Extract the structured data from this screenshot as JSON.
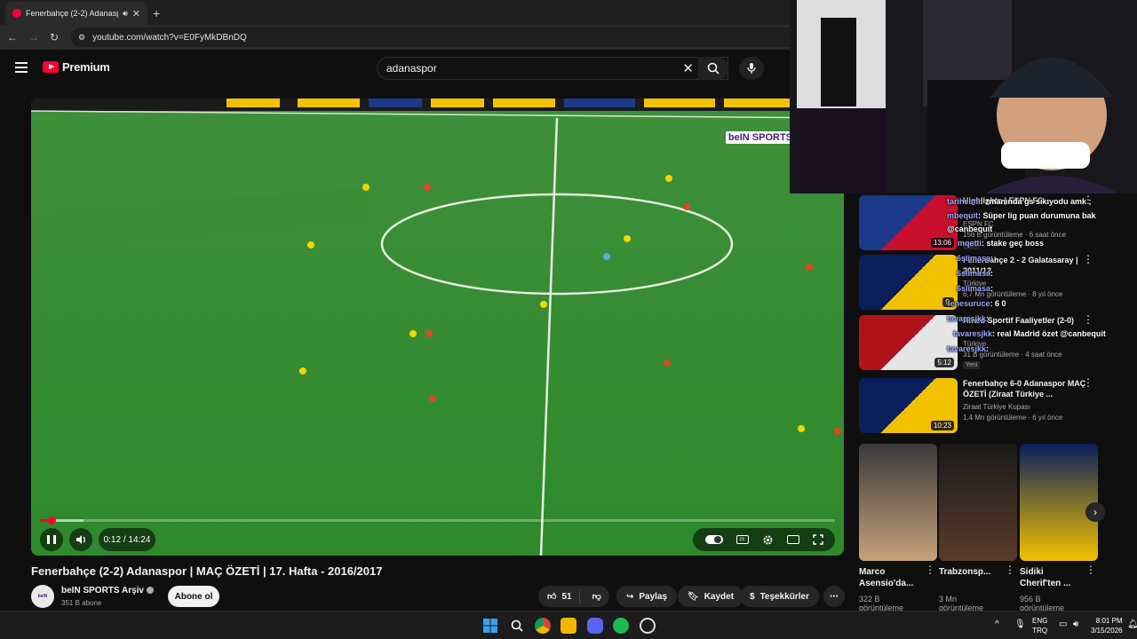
{
  "browser": {
    "tab_title": "Fenerbahçe (2-2) Adanaspo",
    "url": "youtube.com/watch?v=E0FyMkDBnDQ"
  },
  "header": {
    "logo_text": "Premium",
    "search_value": "adanaspor"
  },
  "player": {
    "time": "0:12 / 14:24",
    "progress": 0.014,
    "buffered": 0.055,
    "watermark": "beIN SPORTS"
  },
  "video": {
    "title": "Fenerbahçe (2-2) Adanaspor | MAÇ ÖZETİ | 17. Hafta - 2016/2017",
    "channel": "beIN SPORTS Arşiv",
    "subscribers": "351 B abone",
    "subscribe_label": "Abone ol",
    "likes": "51",
    "share_label": "Paylaş",
    "save_label": "Kaydet",
    "thanks_label": "Teşekkürler"
  },
  "recommendations": [
    {
      "title": "Highlights | ESPN FC",
      "channel": "ESPN FC",
      "meta": "156 B görüntüleme · 6 saat önce",
      "badge": "Yeni",
      "duration": "13:06",
      "colors": [
        "#1b3a8a",
        "#c8102e"
      ]
    },
    {
      "title": "Fenerbahçe 2 - 2 Galatasaray | 2011/12",
      "channel": "Türkiye",
      "meta": "6,7 Mn görüntüleme · 8 yıl önce",
      "badge": "",
      "duration": "9:",
      "colors": [
        "#0a1f5c",
        "#f2c200"
      ]
    },
    {
      "title": "Amed Sportif Faaliyetler (2-0)",
      "channel": "Türkiye",
      "meta": "31 B görüntüleme · 4 saat önce",
      "badge": "Yeni",
      "duration": "5:12",
      "colors": [
        "#b0141b",
        "#e6e6e6"
      ]
    },
    {
      "title": "Fenerbahçe 6-0 Adanaspor MAÇ ÖZETİ (Ziraat Türkiye ...",
      "channel": "Ziraat Türkiye Kupası",
      "meta": "1,4 Mn görüntüleme · 6 yıl önce",
      "badge": "",
      "duration": "10:23",
      "colors": [
        "#0a1f5c",
        "#f2c200"
      ]
    }
  ],
  "chat": [
    {
      "user": "tarihelmi",
      "msg": ": zmanında gs sıkıyodu amk ;"
    },
    {
      "user": "mbequit",
      "msg": ": Süper lig puan durumuna bak"
    },
    {
      "user": "",
      "msg": "@canbequit"
    },
    {
      "user": "mqetti",
      "msg": ": stake geç boss"
    },
    {
      "user": "6slimasa",
      "msg": ":"
    },
    {
      "user": "6slimasa",
      "msg": ":"
    },
    {
      "user": "6slimasa",
      "msg": ":"
    },
    {
      "user": "lenesuruce",
      "msg": ": 6 0"
    },
    {
      "user": "tavaresjkk",
      "msg": ":"
    },
    {
      "user": "tavaresjkk",
      "msg": ": real Madrid özet @canbequit"
    },
    {
      "user": "tavaresjkk",
      "msg": ":"
    }
  ],
  "shorts": [
    {
      "title": "Marco Asensio'da...",
      "views": "322 B",
      "colors": [
        "#3a3a3a",
        "#c9a27a"
      ]
    },
    {
      "title": "Trabzonsp...",
      "views": "3 Mn",
      "colors": [
        "#1a1a1a",
        "#5b3b2b"
      ]
    },
    {
      "title": "Sidiki Cherif'ten ...",
      "views": "956 B",
      "colors": [
        "#0a1f5c",
        "#f2c200"
      ]
    }
  ],
  "shorts_views_suffix": "görüntüleme",
  "taskbar": {
    "lang": "ENG",
    "lang2": "TRQ",
    "time": "8:01 PM",
    "date": "3/15/2026"
  }
}
